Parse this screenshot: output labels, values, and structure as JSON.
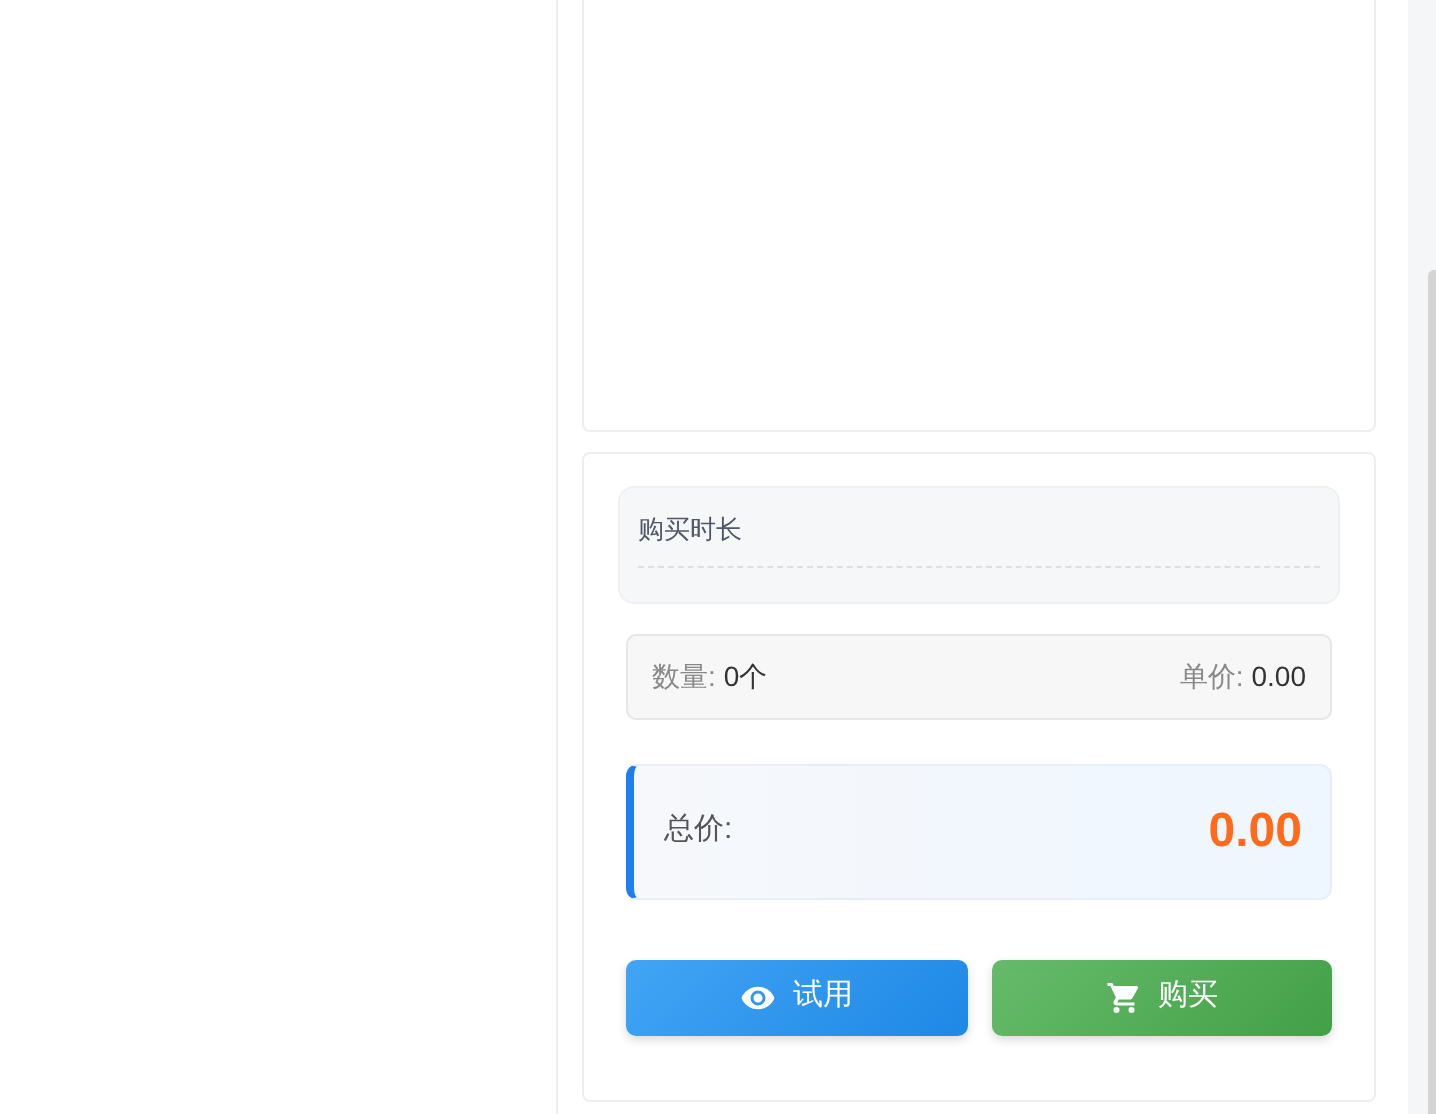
{
  "duration": {
    "title": "购买时长"
  },
  "summary": [
    {
      "label": "数量:",
      "value": "0个"
    },
    {
      "label": "单价:",
      "value": "0.00"
    }
  ],
  "total": {
    "label": "总价:",
    "value": "0.00"
  },
  "buttons": [
    {
      "kind": "trial",
      "label": "试用"
    },
    {
      "kind": "buy",
      "label": "购买"
    }
  ]
}
